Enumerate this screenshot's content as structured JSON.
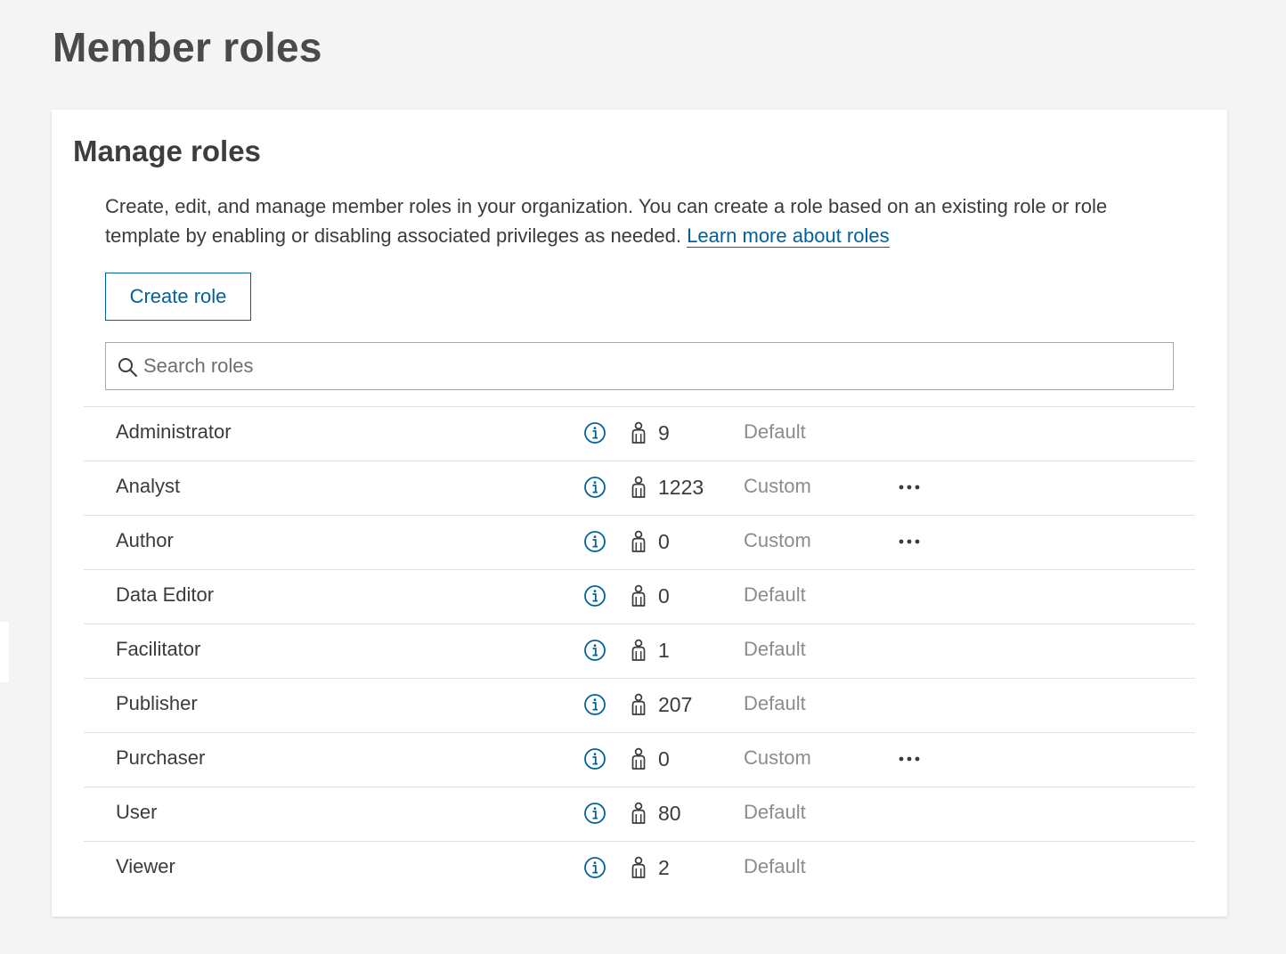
{
  "page": {
    "title": "Member roles"
  },
  "manage_roles": {
    "title": "Manage roles",
    "description": "Create, edit, and manage member roles in your organization. You can create a role based on an existing role or role template by enabling or disabling associated privileges as needed.",
    "learn_more_link": "Learn more about roles",
    "create_role_button": "Create role",
    "search": {
      "placeholder": "Search roles",
      "value": ""
    },
    "roles": [
      {
        "name": "Administrator",
        "members": "9",
        "type": "Default",
        "has_menu": false
      },
      {
        "name": "Analyst",
        "members": "1223",
        "type": "Custom",
        "has_menu": true
      },
      {
        "name": "Author",
        "members": "0",
        "type": "Custom",
        "has_menu": true
      },
      {
        "name": "Data Editor",
        "members": "0",
        "type": "Default",
        "has_menu": false
      },
      {
        "name": "Facilitator",
        "members": "1",
        "type": "Default",
        "has_menu": false
      },
      {
        "name": "Publisher",
        "members": "207",
        "type": "Default",
        "has_menu": false
      },
      {
        "name": "Purchaser",
        "members": "0",
        "type": "Custom",
        "has_menu": true
      },
      {
        "name": "User",
        "members": "80",
        "type": "Default",
        "has_menu": false
      },
      {
        "name": "Viewer",
        "members": "2",
        "type": "Default",
        "has_menu": false
      }
    ]
  },
  "icons": {
    "search": "search-icon",
    "info": "info-icon",
    "members": "user-icon",
    "more": "more-horizontal-icon"
  },
  "colors": {
    "accent": "#00619b",
    "background": "#f4f4f4",
    "card": "#ffffff",
    "muted_text": "#8c8c8c"
  }
}
